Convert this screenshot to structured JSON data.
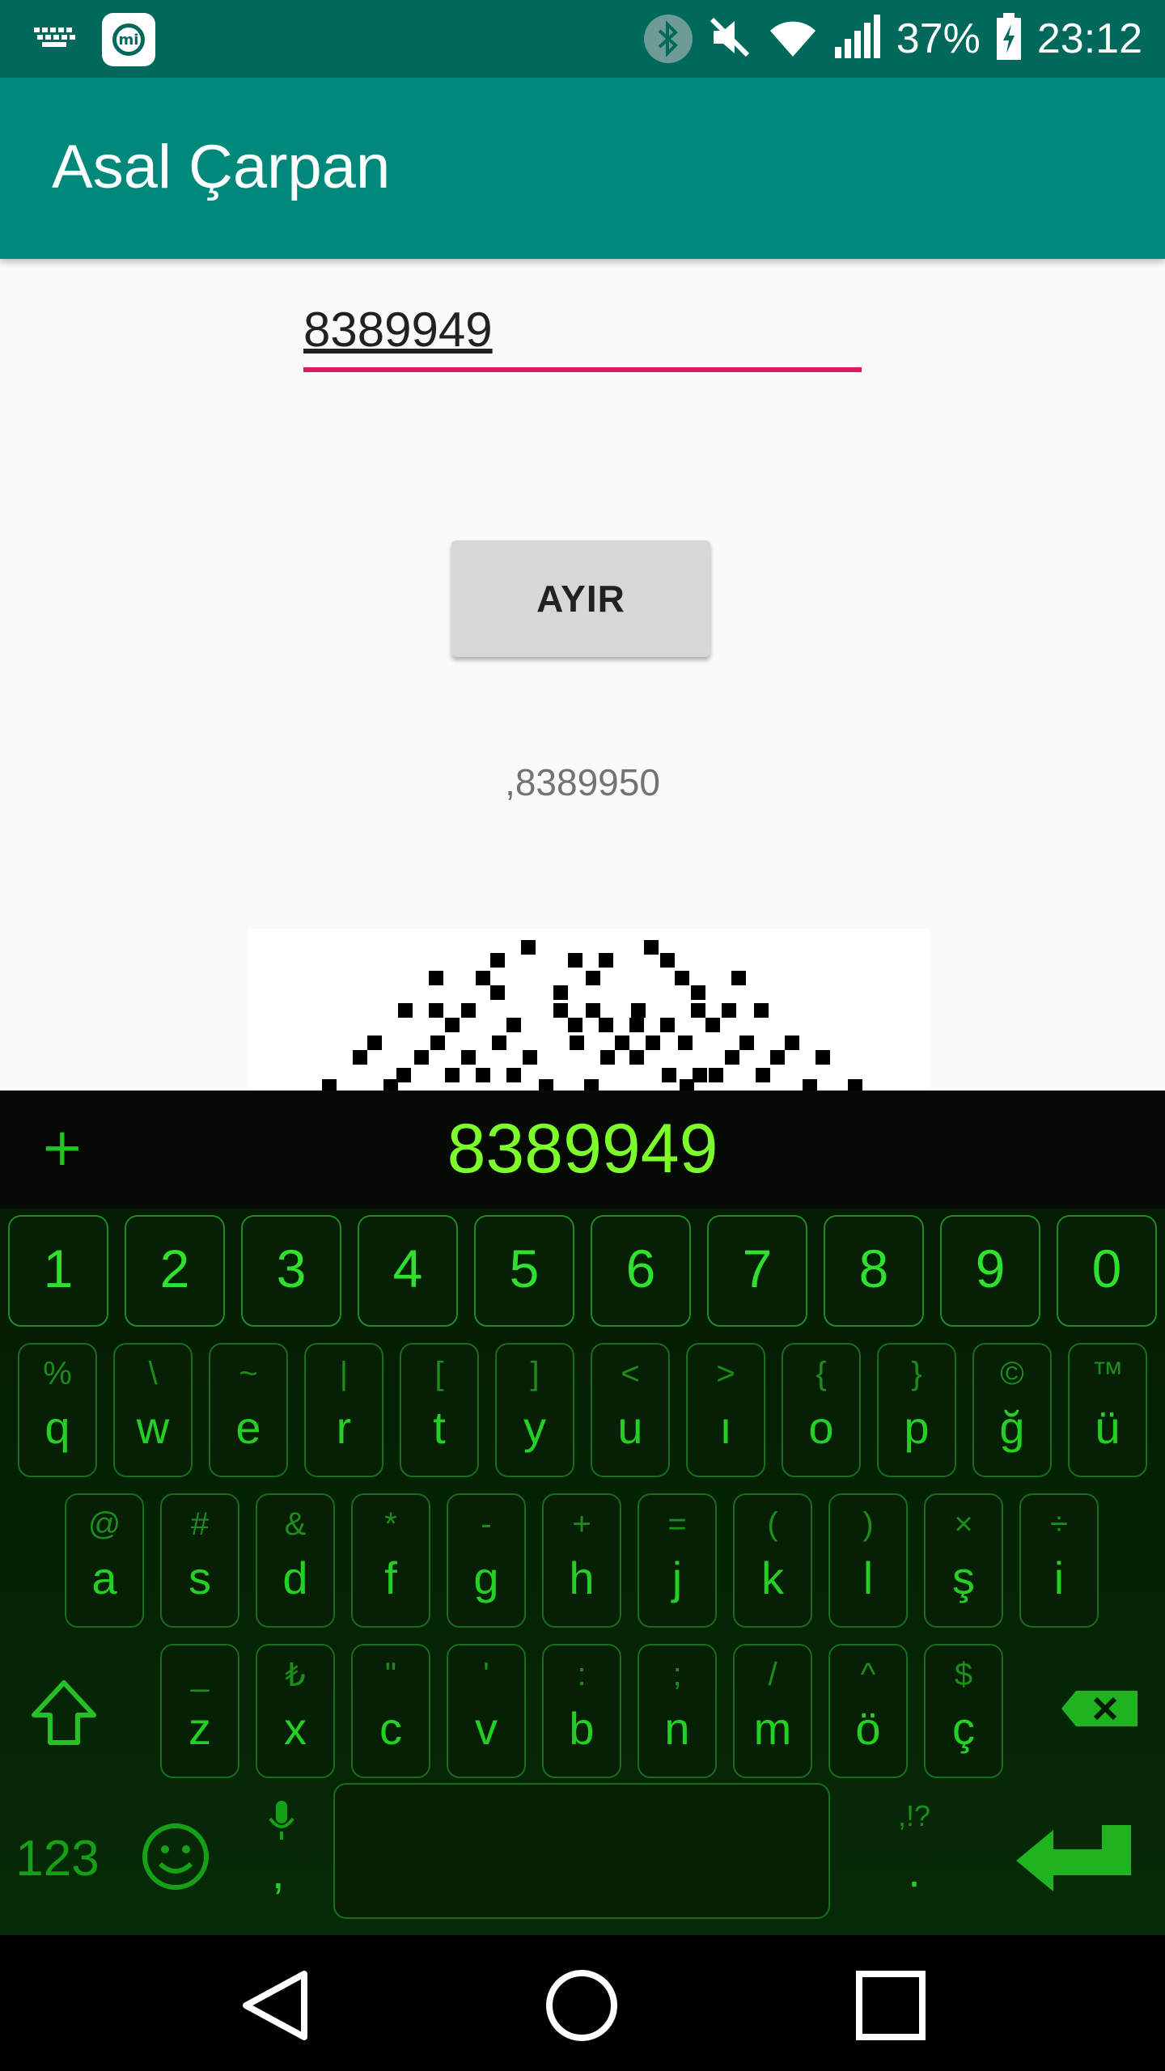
{
  "status_bar": {
    "battery": "37%",
    "time": "23:12",
    "icons": [
      "keyboard-icon",
      "mi-app-icon",
      "bluetooth-icon",
      "mute-icon",
      "wifi-icon",
      "signal-icon",
      "battery-icon"
    ]
  },
  "app_bar": {
    "title": "Asal Çarpan"
  },
  "main": {
    "input_value": "8389949",
    "button_label": "AYIR",
    "result_text": ",8389950"
  },
  "keyboard": {
    "preview": "8389949",
    "numbers": [
      "1",
      "2",
      "3",
      "4",
      "5",
      "6",
      "7",
      "8",
      "9",
      "0"
    ],
    "row1": [
      {
        "sub": "%",
        "main": "q"
      },
      {
        "sub": "\\",
        "main": "w"
      },
      {
        "sub": "~",
        "main": "e"
      },
      {
        "sub": "|",
        "main": "r"
      },
      {
        "sub": "[",
        "main": "t"
      },
      {
        "sub": "]",
        "main": "y"
      },
      {
        "sub": "<",
        "main": "u"
      },
      {
        "sub": ">",
        "main": "ı"
      },
      {
        "sub": "{",
        "main": "o"
      },
      {
        "sub": "}",
        "main": "p"
      },
      {
        "sub": "©",
        "main": "ğ"
      },
      {
        "sub": "™",
        "main": "ü"
      }
    ],
    "row2": [
      {
        "sub": "@",
        "main": "a"
      },
      {
        "sub": "#",
        "main": "s"
      },
      {
        "sub": "&",
        "main": "d"
      },
      {
        "sub": "*",
        "main": "f"
      },
      {
        "sub": "-",
        "main": "g"
      },
      {
        "sub": "+",
        "main": "h"
      },
      {
        "sub": "=",
        "main": "j"
      },
      {
        "sub": "(",
        "main": "k"
      },
      {
        "sub": ")",
        "main": "l"
      },
      {
        "sub": "×",
        "main": "ş"
      },
      {
        "sub": "÷",
        "main": "i"
      }
    ],
    "row3": [
      {
        "sub": "_",
        "main": "z"
      },
      {
        "sub": "₺",
        "main": "x"
      },
      {
        "sub": "\"",
        "main": "c"
      },
      {
        "sub": "'",
        "main": "v"
      },
      {
        "sub": ":",
        "main": "b"
      },
      {
        "sub": ";",
        "main": "n"
      },
      {
        "sub": "/",
        "main": "m"
      },
      {
        "sub": "^",
        "main": "ö"
      },
      {
        "sub": "$",
        "main": "ç"
      }
    ],
    "symbols_label": "123",
    "comma_label": ",",
    "punct_hint": ",!?",
    "period_label": "."
  },
  "colors": {
    "status_bar": "#00695c",
    "app_bar": "#00897b",
    "accent": "#d81b60",
    "keyboard_green": "#25d025"
  }
}
